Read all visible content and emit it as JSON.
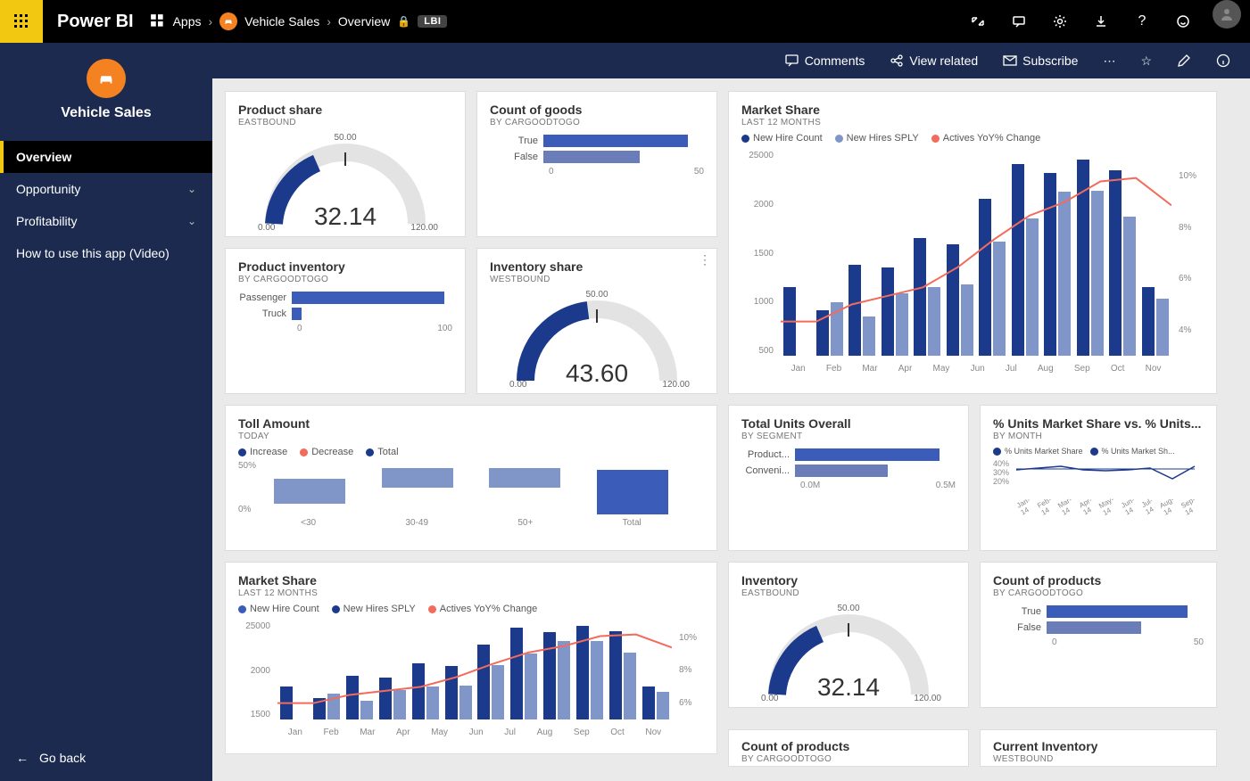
{
  "topbar": {
    "brand": "Power BI",
    "apps_label": "Apps",
    "workspace": "Vehicle Sales",
    "page": "Overview",
    "tag": "LBI"
  },
  "actionbar": {
    "comments": "Comments",
    "view_related": "View related",
    "subscribe": "Subscribe"
  },
  "sidebar": {
    "title": "Vehicle Sales",
    "items": [
      {
        "label": "Overview",
        "active": true,
        "expandable": false
      },
      {
        "label": "Opportunity",
        "active": false,
        "expandable": true
      },
      {
        "label": "Profitability",
        "active": false,
        "expandable": true
      },
      {
        "label": "How to use this app (Video)",
        "active": false,
        "expandable": false
      }
    ],
    "goback": "Go back"
  },
  "tiles": {
    "productShare": {
      "title": "Product share",
      "sub": "EASTBOUND",
      "min": "0.00",
      "mid": "50.00",
      "max": "120.00",
      "value": "32.14"
    },
    "countGoods": {
      "title": "Count of goods",
      "sub": "BY CARGOODTOGO",
      "rows": [
        {
          "label": "True",
          "value": 55,
          "cls": ""
        },
        {
          "label": "False",
          "value": 38,
          "cls": "alt"
        }
      ],
      "axis": [
        "0",
        "50"
      ]
    },
    "productInventory": {
      "title": "Product inventory",
      "sub": "BY CARGOODTOGO",
      "rows": [
        {
          "label": "Passenger",
          "value": 145
        },
        {
          "label": "Truck",
          "value": 8
        }
      ],
      "axis": [
        "0",
        "100"
      ]
    },
    "inventoryShare": {
      "title": "Inventory share",
      "sub": "WESTBOUND",
      "min": "0.00",
      "mid": "50.00",
      "max": "120.00",
      "value": "43.60"
    },
    "marketShare": {
      "title": "Market Share",
      "sub": "LAST 12 MONTHS",
      "legend": [
        "New Hire Count",
        "New Hires SPLY",
        "Actives YoY% Change"
      ],
      "months": [
        "Jan",
        "Feb",
        "Mar",
        "Apr",
        "May",
        "Jun",
        "Jul",
        "Aug",
        "Sep",
        "Oct",
        "Nov"
      ],
      "y": [
        "25000",
        "2000",
        "1500",
        "1000",
        "500"
      ],
      "yR": [
        "10%",
        "8%",
        "6%",
        "4%"
      ],
      "barsA": [
        770,
        510,
        1020,
        990,
        1320,
        1250,
        1760,
        2150,
        2050,
        2200,
        2080,
        770
      ],
      "barsB": [
        0,
        600,
        440,
        700,
        770,
        800,
        1280,
        1540,
        1840,
        1850,
        1560,
        640
      ],
      "line": [
        2,
        2,
        3,
        3.5,
        4,
        5.2,
        6.8,
        8.2,
        9,
        10.2,
        10.4,
        8.8
      ]
    },
    "tollAmount": {
      "title": "Toll Amount",
      "sub": "TODAY",
      "legend": [
        "Increase",
        "Decrease",
        "Total"
      ],
      "y": [
        "50%",
        "0%"
      ],
      "x": [
        "<30",
        "30-49",
        "50+",
        "Total"
      ],
      "bars": [
        {
          "v": 28,
          "cls": ""
        },
        {
          "v": 22,
          "cls": ""
        },
        {
          "v": 22,
          "cls": ""
        },
        {
          "v": 50,
          "cls": "total"
        }
      ],
      "offsets": [
        12,
        30,
        30,
        0
      ]
    },
    "totalUnits": {
      "title": "Total Units Overall",
      "sub": "BY SEGMENT",
      "rows": [
        {
          "label": "Product...",
          "value": 55
        },
        {
          "label": "Conveni...",
          "value": 36
        }
      ],
      "axis": [
        "0.0M",
        "0.5M"
      ]
    },
    "unitsMS": {
      "title": "% Units Market Share vs. % Units...",
      "sub": "BY MONTH",
      "legend": [
        "% Units Market Share",
        "% Units Market Sh..."
      ],
      "y": [
        "40%",
        "30%",
        "20%"
      ],
      "x": [
        "Jan-14",
        "Feb-14",
        "Mar-14",
        "Apr-14",
        "May-14",
        "Jun-14",
        "Jul-14",
        "Aug-14",
        "Sep-14"
      ]
    },
    "marketShare2": {
      "title": "Market Share",
      "sub": "LAST 12 MONTHS",
      "legend": [
        "New Hire Count",
        "New Hires SPLY",
        "Actives YoY% Change"
      ],
      "y": [
        "25000",
        "2000",
        "1500"
      ],
      "yR": [
        "10%",
        "8%",
        "6%"
      ]
    },
    "inventory": {
      "title": "Inventory",
      "sub": "EASTBOUND",
      "min": "0.00",
      "mid": "50.00",
      "max": "120.00",
      "value": "32.14"
    },
    "countProducts": {
      "title": "Count of products",
      "sub": "BY CARGOODTOGO",
      "rows": [
        {
          "label": "True",
          "value": 55,
          "cls": ""
        },
        {
          "label": "False",
          "value": 38,
          "cls": "alt"
        }
      ],
      "axis": [
        "0",
        "50"
      ]
    },
    "stub1": {
      "title": "Count of products",
      "sub": "BY CARGOODTOGO"
    },
    "stub2": {
      "title": "Current Inventory",
      "sub": "WESTBOUND"
    }
  },
  "chart_data": [
    {
      "type": "bar",
      "id": "marketShare",
      "title": "Market Share",
      "xlabel": "",
      "ylabel": "",
      "categories": [
        "Jan",
        "Feb",
        "Mar",
        "Apr",
        "May",
        "Jun",
        "Jul",
        "Aug",
        "Sep",
        "Oct",
        "Nov"
      ],
      "series": [
        {
          "name": "New Hire Count",
          "values": [
            770,
            510,
            1020,
            990,
            1320,
            1250,
            1760,
            2150,
            2050,
            2200,
            2080,
            770
          ]
        },
        {
          "name": "New Hires SPLY",
          "values": [
            0,
            600,
            440,
            700,
            770,
            800,
            1280,
            1540,
            1840,
            1850,
            1560,
            640
          ]
        },
        {
          "name": "Actives YoY% Change",
          "values": [
            2,
            2,
            3,
            3.5,
            4,
            5.2,
            6.8,
            8.2,
            9,
            10.2,
            10.4,
            8.8
          ],
          "axis": "right",
          "type": "line"
        }
      ],
      "ylim": [
        0,
        2500
      ],
      "ylim_right": [
        0,
        12
      ]
    },
    {
      "type": "bar",
      "id": "productShareGauge",
      "title": "Product share",
      "categories": [
        "value"
      ],
      "values": [
        32.14
      ],
      "ylim": [
        0,
        120
      ]
    },
    {
      "type": "bar",
      "id": "inventoryShareGauge",
      "title": "Inventory share",
      "categories": [
        "value"
      ],
      "values": [
        43.6
      ],
      "ylim": [
        0,
        120
      ]
    },
    {
      "type": "bar",
      "id": "countGoods",
      "title": "Count of goods",
      "categories": [
        "True",
        "False"
      ],
      "values": [
        55,
        38
      ]
    },
    {
      "type": "bar",
      "id": "productInventory",
      "title": "Product inventory",
      "categories": [
        "Passenger",
        "Truck"
      ],
      "values": [
        145,
        8
      ]
    },
    {
      "type": "bar",
      "id": "tollAmount",
      "title": "Toll Amount",
      "categories": [
        "<30",
        "30-49",
        "50+",
        "Total"
      ],
      "values": [
        28,
        22,
        22,
        50
      ],
      "note": "waterfall"
    },
    {
      "type": "bar",
      "id": "totalUnits",
      "title": "Total Units Overall",
      "categories": [
        "Productivity",
        "Convenience"
      ],
      "values": [
        0.55,
        0.36
      ],
      "unit": "M"
    },
    {
      "type": "line",
      "id": "unitsMS",
      "title": "% Units Market Share vs. % Units...",
      "x": [
        "Jan-14",
        "Feb-14",
        "Mar-14",
        "Apr-14",
        "May-14",
        "Jun-14",
        "Jul-14",
        "Aug-14",
        "Sep-14"
      ],
      "series": [
        {
          "name": "% Units Market Share",
          "values": [
            33,
            34,
            36,
            33,
            32,
            33,
            34,
            26,
            36
          ]
        },
        {
          "name": "% Units Market Sh...",
          "values": [
            34,
            34,
            34,
            34,
            34,
            34,
            34,
            34,
            34
          ]
        }
      ],
      "ylim": [
        20,
        40
      ]
    }
  ]
}
